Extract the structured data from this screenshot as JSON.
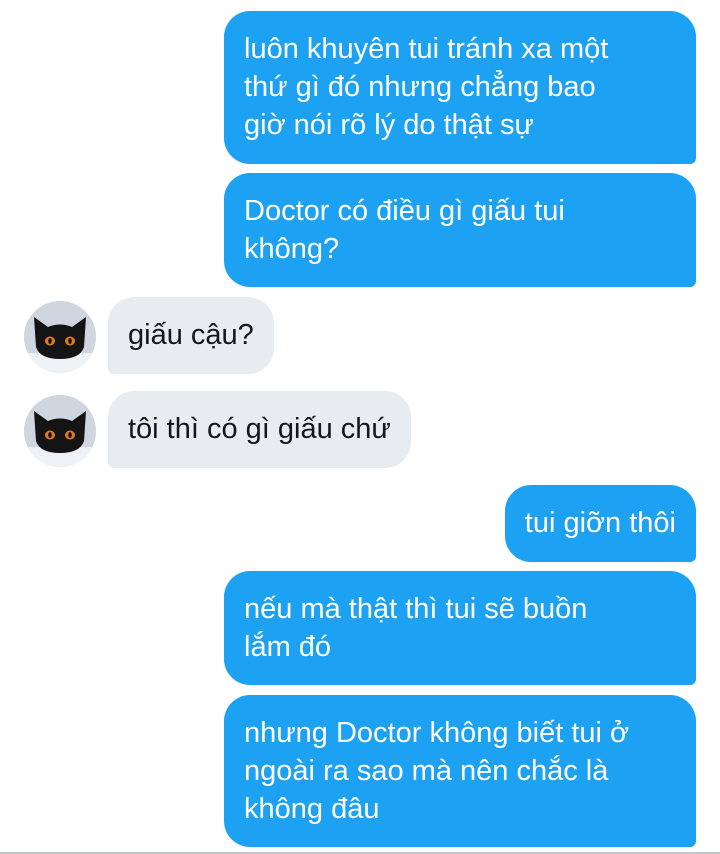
{
  "conversation": {
    "messages": [
      {
        "sender": "me",
        "text": "luôn khuyên tui tránh xa một\nthứ gì đó nhưng chẳng bao\ngiờ nói rõ lý do thật sự"
      },
      {
        "sender": "me",
        "text": "Doctor có điều gì giấu tui\nkhông?"
      },
      {
        "sender": "other",
        "text": "giấu cậu?"
      },
      {
        "sender": "other",
        "text": "tôi thì có gì giấu chứ"
      },
      {
        "sender": "me",
        "text": "tui giỡn thôi"
      },
      {
        "sender": "me",
        "text": "nếu mà thật thì tui sẽ buồn\nlắm đó"
      },
      {
        "sender": "me",
        "text": "nhưng Doctor không biết tui ở\nngoài ra sao mà nên chắc là\nkhông đâu"
      }
    ]
  },
  "icons": {
    "avatar": "black-cat-avatar-icon"
  },
  "colors": {
    "outgoing_bubble": "#1da1f2",
    "incoming_bubble": "#e6ecf0",
    "outgoing_text": "#ffffff",
    "incoming_text": "#14171a",
    "background": "#ffffff"
  }
}
